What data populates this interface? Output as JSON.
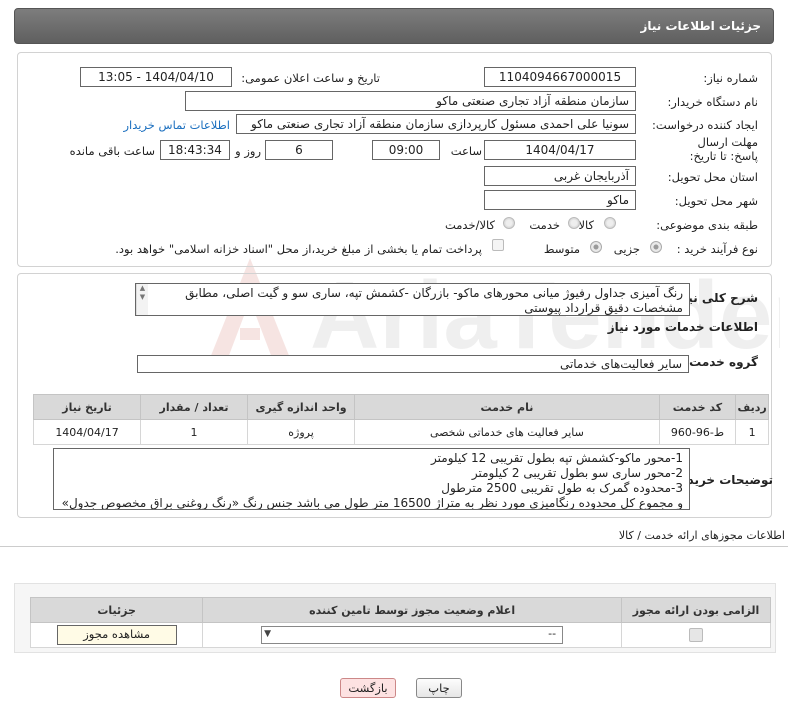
{
  "header": {
    "title": "جزئیات اطلاعات نیاز"
  },
  "watermark": {
    "text": "AriaTender.net"
  },
  "fields": {
    "need_number_label": "شماره نیاز:",
    "need_number": "1104094667000015",
    "announce_label": "تاریخ و ساعت اعلان عمومی:",
    "announce_value": "1404/04/10 - 13:05",
    "buyer_org_label": "نام دستگاه خریدار:",
    "buyer_org": "سازمان منطقه آزاد تجاری   صنعتی ماکو",
    "creator_label": "ایجاد کننده درخواست:",
    "creator": "سونیا علی احمدی مسئول کارپردازی سازمان منطقه آزاد تجاری   صنعتی ماکو",
    "contact_link": "اطلاعات تماس خریدار",
    "deadline_label": "مهلت ارسال پاسخ: تا تاریخ:",
    "deadline_date": "1404/04/17",
    "time_label": "ساعت",
    "deadline_time": "09:00",
    "days_value": "6",
    "days_label": "روز و",
    "remaining_value": "18:43:34",
    "remaining_label": "ساعت باقی مانده",
    "province_label": "استان محل تحویل:",
    "province": "آذربایجان غربی",
    "city_label": "شهر محل تحویل:",
    "city": "ماکو",
    "category_label": "طبقه بندی موضوعی:",
    "category_options": [
      "کالا",
      "خدمت",
      "کالا/خدمت"
    ],
    "category_selected": "خدمت",
    "process_label": "نوع فرآیند خرید :",
    "process_options": [
      "جزیی",
      "متوسط"
    ],
    "process_selected": "جزیی",
    "payment_note": "پرداخت تمام یا بخشی از مبلغ خرید،از محل \"اسناد خزانه اسلامی\" خواهد بود."
  },
  "summary": {
    "label": "شرح کلی نیاز:",
    "text": "رنگ آمیزی جداول رفیوژ میانی محورهای ماکو- بازرگان -کشمش تپه، ساری سو و گیت اصلی، مطابق مشخصات دقیق قرارداد پیوستی"
  },
  "services": {
    "section_title": "اطلاعات خدمات مورد نیاز",
    "group_label": "گروه خدمت:",
    "group_value": "سایر فعالیت‌های خدماتی",
    "columns": [
      "ردیف",
      "کد خدمت",
      "نام خدمت",
      "واحد اندازه گیری",
      "تعداد / مقدار",
      "تاریخ نیاز"
    ],
    "rows": [
      [
        "1",
        "ط-96-960",
        "سایر فعالیت های خدماتی شخصی",
        "پروژه",
        "1",
        "1404/04/17"
      ]
    ]
  },
  "buyer_notes": {
    "label": "توضیحات خریدار:",
    "lines": [
      "1-محور ماکو-کشمش تپه بطول تقریبی 12 کیلومتر",
      "2-محور ساری سو بطول تقریبی 2 کیلومتر",
      "3-محدوده گمرک به طول تقریبی 2500 مترطول",
      "و مجموع کل محدوده رنگامیزی مورد نظر به متراژ 16500 متر طول می باشد جنس رنگ «رنگ روغنی براق مخصوص جدول»"
    ]
  },
  "permits": {
    "section_title": "اطلاعات مجوزهای ارائه خدمت / کالا",
    "columns": [
      "الزامی بودن ارائه مجوز",
      "اعلام وضعیت مجوز توسط تامین کننده",
      "جزئیات"
    ],
    "select_value": "--",
    "view_button": "مشاهده مجوز"
  },
  "buttons": {
    "print": "چاپ",
    "back": "بازگشت"
  }
}
